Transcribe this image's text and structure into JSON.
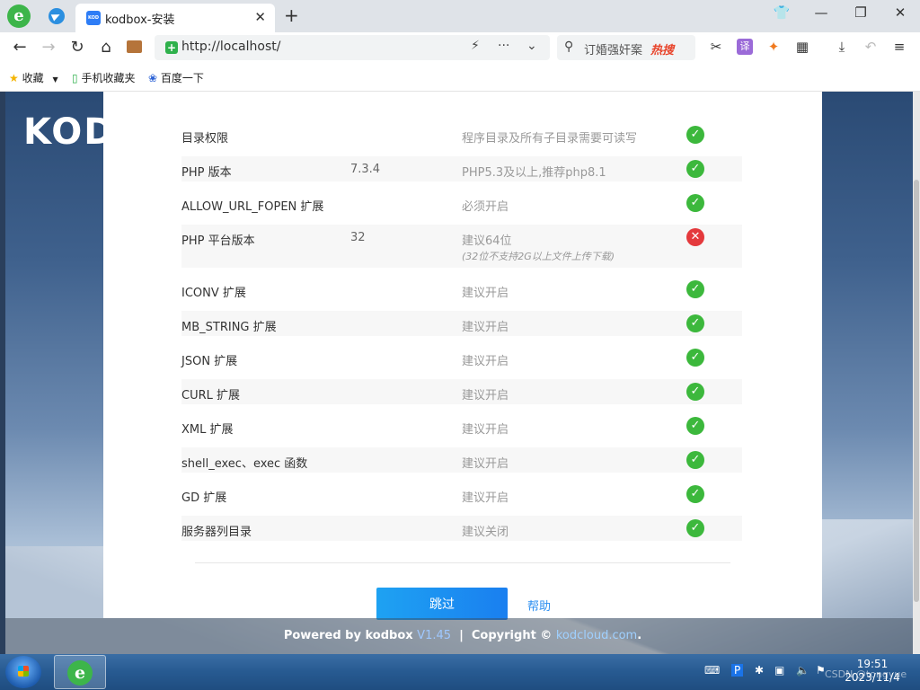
{
  "browser": {
    "tab_title": "kodbox-安装",
    "tab_favicon_text": "KOD",
    "url": "http://localhost/",
    "search_hint": "订婚强奸案",
    "hot_label": "热搜"
  },
  "bookmarks": [
    {
      "label": "收藏"
    },
    {
      "label": "手机收藏夹"
    },
    {
      "label": "百度一下"
    }
  ],
  "page": {
    "brand": "KOD",
    "checks": [
      {
        "name": "目录权限",
        "value": "",
        "requirement": "程序目录及所有子目录需要可读写",
        "note": "",
        "status": "ok"
      },
      {
        "name": "PHP 版本",
        "value": "7.3.4",
        "requirement": "PHP5.3及以上,推荐php8.1",
        "note": "",
        "status": "ok"
      },
      {
        "name": "ALLOW_URL_FOPEN 扩展",
        "value": "",
        "requirement": "必须开启",
        "note": "",
        "status": "ok"
      },
      {
        "name": "PHP 平台版本",
        "value": "32",
        "requirement": "建议64位",
        "note": "(32位不支持2G以上文件上传下载)",
        "status": "fail"
      },
      {
        "name": "ICONV 扩展",
        "value": "",
        "requirement": "建议开启",
        "note": "",
        "status": "ok"
      },
      {
        "name": "MB_STRING 扩展",
        "value": "",
        "requirement": "建议开启",
        "note": "",
        "status": "ok"
      },
      {
        "name": "JSON 扩展",
        "value": "",
        "requirement": "建议开启",
        "note": "",
        "status": "ok"
      },
      {
        "name": "CURL 扩展",
        "value": "",
        "requirement": "建议开启",
        "note": "",
        "status": "ok"
      },
      {
        "name": "XML 扩展",
        "value": "",
        "requirement": "建议开启",
        "note": "",
        "status": "ok"
      },
      {
        "name": "shell_exec、exec 函数",
        "value": "",
        "requirement": "建议开启",
        "note": "",
        "status": "ok"
      },
      {
        "name": "GD 扩展",
        "value": "",
        "requirement": "建议开启",
        "note": "",
        "status": "ok"
      },
      {
        "name": "服务器列目录",
        "value": "",
        "requirement": "建议关闭",
        "note": "",
        "status": "ok"
      }
    ],
    "skip_label": "跳过",
    "help_label": "帮助",
    "footer": {
      "powered": "Powered by kodbox",
      "version": "V1.45",
      "sep": "|",
      "copyright": "Copyright ©",
      "link": "kodcloud.com",
      "dot": "."
    }
  },
  "taskbar": {
    "time": "19:51",
    "date": "2023/11/4",
    "watermark": "CSDN @tongyue"
  },
  "colors": {
    "ok": "#3cb83c",
    "fail": "#e4393c",
    "primary": "#1a8cf0"
  }
}
